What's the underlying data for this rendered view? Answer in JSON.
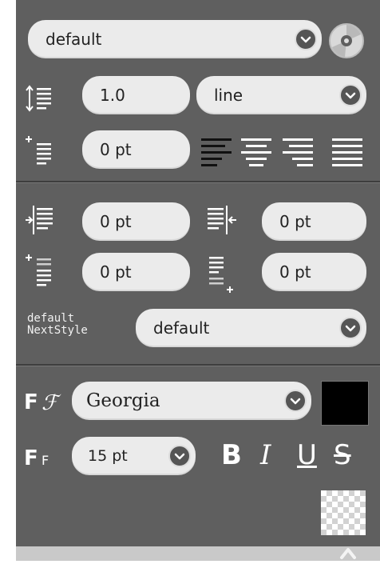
{
  "style_select": {
    "value": "default"
  },
  "line_height": {
    "value": "1.0",
    "unit": "line"
  },
  "space_before": {
    "value": "0 pt"
  },
  "indent_left": {
    "value": "0 pt"
  },
  "indent_right": {
    "value": "0 pt"
  },
  "para_space_before": {
    "value": "0 pt"
  },
  "para_space_after": {
    "value": "0 pt"
  },
  "next_style": {
    "label_line1": "default",
    "label_line2": "NextStyle",
    "value": "default"
  },
  "font": {
    "family": "Georgia",
    "size": "15 pt",
    "color": "#000000"
  },
  "format": {
    "bold": "B",
    "italic": "I",
    "underline": "U",
    "strike": "S"
  },
  "icons": [
    "line-height-icon",
    "space-before-icon",
    "align-left-icon",
    "align-center-icon",
    "align-right-icon",
    "align-justify-icon",
    "indent-left-icon",
    "indent-right-icon",
    "para-before-icon",
    "para-after-icon",
    "font-family-icon",
    "font-size-icon",
    "style-disk-icon",
    "chevron-down-icon",
    "scroll-up-icon"
  ]
}
